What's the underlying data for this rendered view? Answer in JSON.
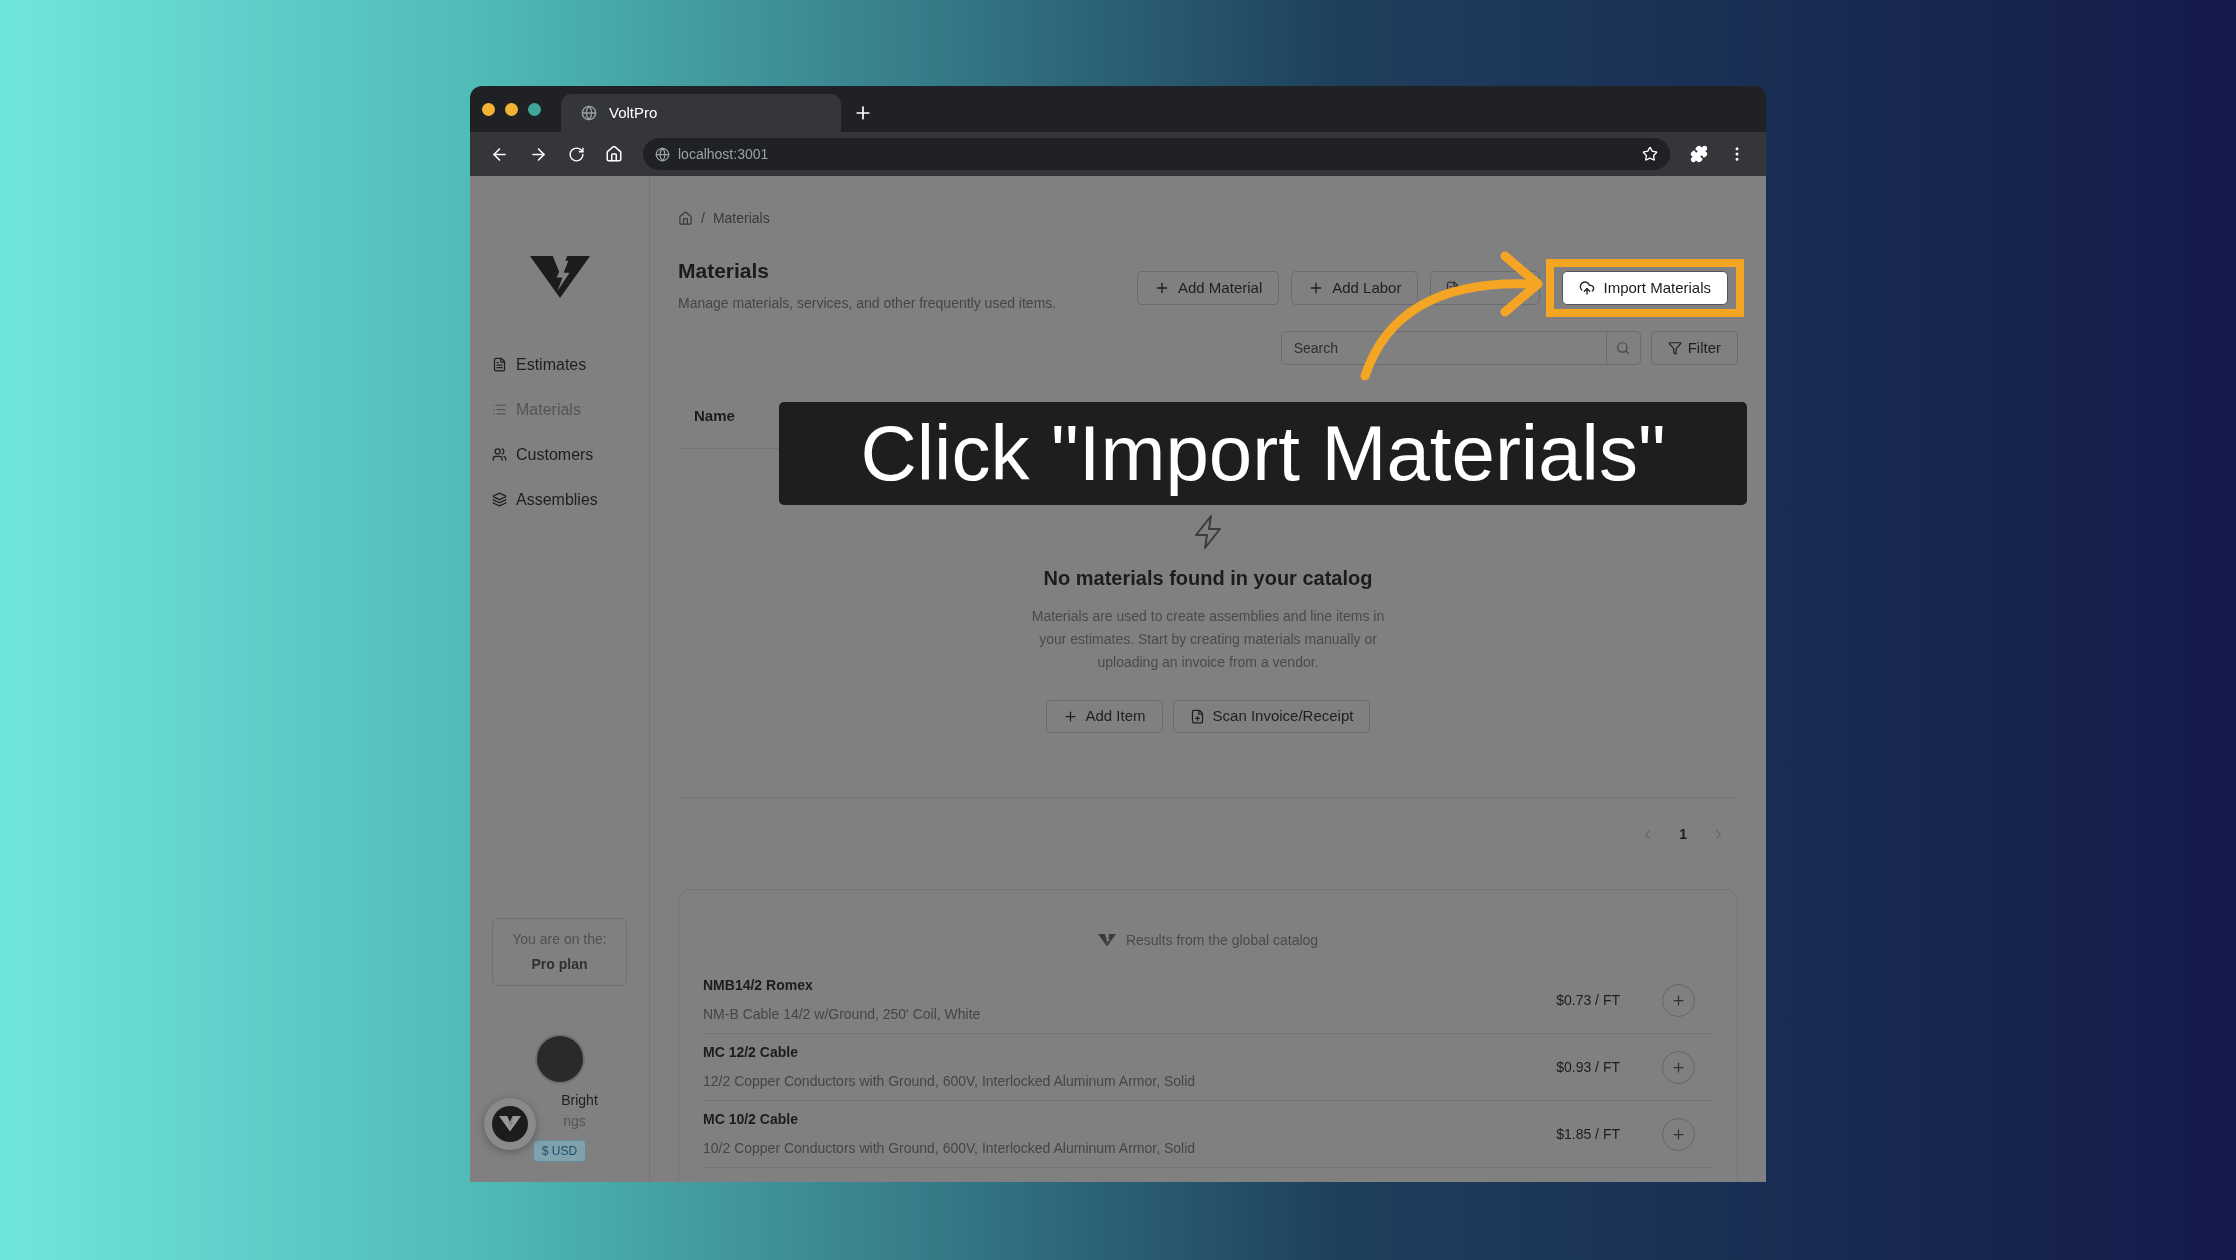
{
  "browser": {
    "tab_title": "VoltPro",
    "url": "localhost:3001"
  },
  "sidebar": {
    "items": [
      {
        "label": "Estimates",
        "kind": "file",
        "selected": false
      },
      {
        "label": "Materials",
        "kind": "list",
        "selected": true
      },
      {
        "label": "Customers",
        "kind": "users",
        "selected": false
      },
      {
        "label": "Assemblies",
        "kind": "layers",
        "selected": false
      }
    ],
    "plan": {
      "line_1": "You are on the:",
      "line_2": "Pro plan"
    },
    "user": {
      "name": "Bright",
      "subtitle": "ngs",
      "currency": "$ USD"
    }
  },
  "breadcrumb": {
    "separator": "/",
    "items": [
      "Materials"
    ]
  },
  "page": {
    "title": "Materials",
    "subtitle": "Manage materials, services, and other frequently used items."
  },
  "actions": [
    {
      "label": "Add Material",
      "kind": "plus",
      "highlighted": false
    },
    {
      "label": "Add Labor",
      "kind": "plus",
      "highlighted": false
    },
    {
      "label": "Import Materials",
      "kind": "upload",
      "highlighted": true
    }
  ],
  "search": {
    "placeholder": "Search"
  },
  "filter": "Filter",
  "table": {
    "columns": [
      "Name"
    ]
  },
  "empty_state": {
    "heading": "No materials found in your catalog",
    "description": "Materials are used to create assemblies and line items in your estimates. Start by creating materials manually or uploading an invoice from a vendor.",
    "buttons": [
      {
        "label": "Add Item",
        "kind": "plus"
      },
      {
        "label": "Scan Invoice/Receipt",
        "kind": "file"
      }
    ]
  },
  "pagination": {
    "pages": [
      {
        "label": "1",
        "selected": true
      }
    ]
  },
  "catalog": {
    "title": "Results from the global catalog",
    "items": [
      {
        "name": "NMB14/2 Romex",
        "description": "NM-B Cable 14/2 w/Ground, 250' Coil, White",
        "price": "$0.73 / FT"
      },
      {
        "name": "MC 12/2 Cable",
        "description": "12/2 Copper Conductors with Ground, 600V, Interlocked Aluminum Armor, Solid",
        "price": "$0.93 / FT"
      },
      {
        "name": "MC 10/2 Cable",
        "description": "10/2 Copper Conductors with Ground, 600V, Interlocked Aluminum Armor, Solid",
        "price": "$1.85 / FT"
      }
    ]
  },
  "tutorial": {
    "caption": "Click \"Import Materials\""
  }
}
